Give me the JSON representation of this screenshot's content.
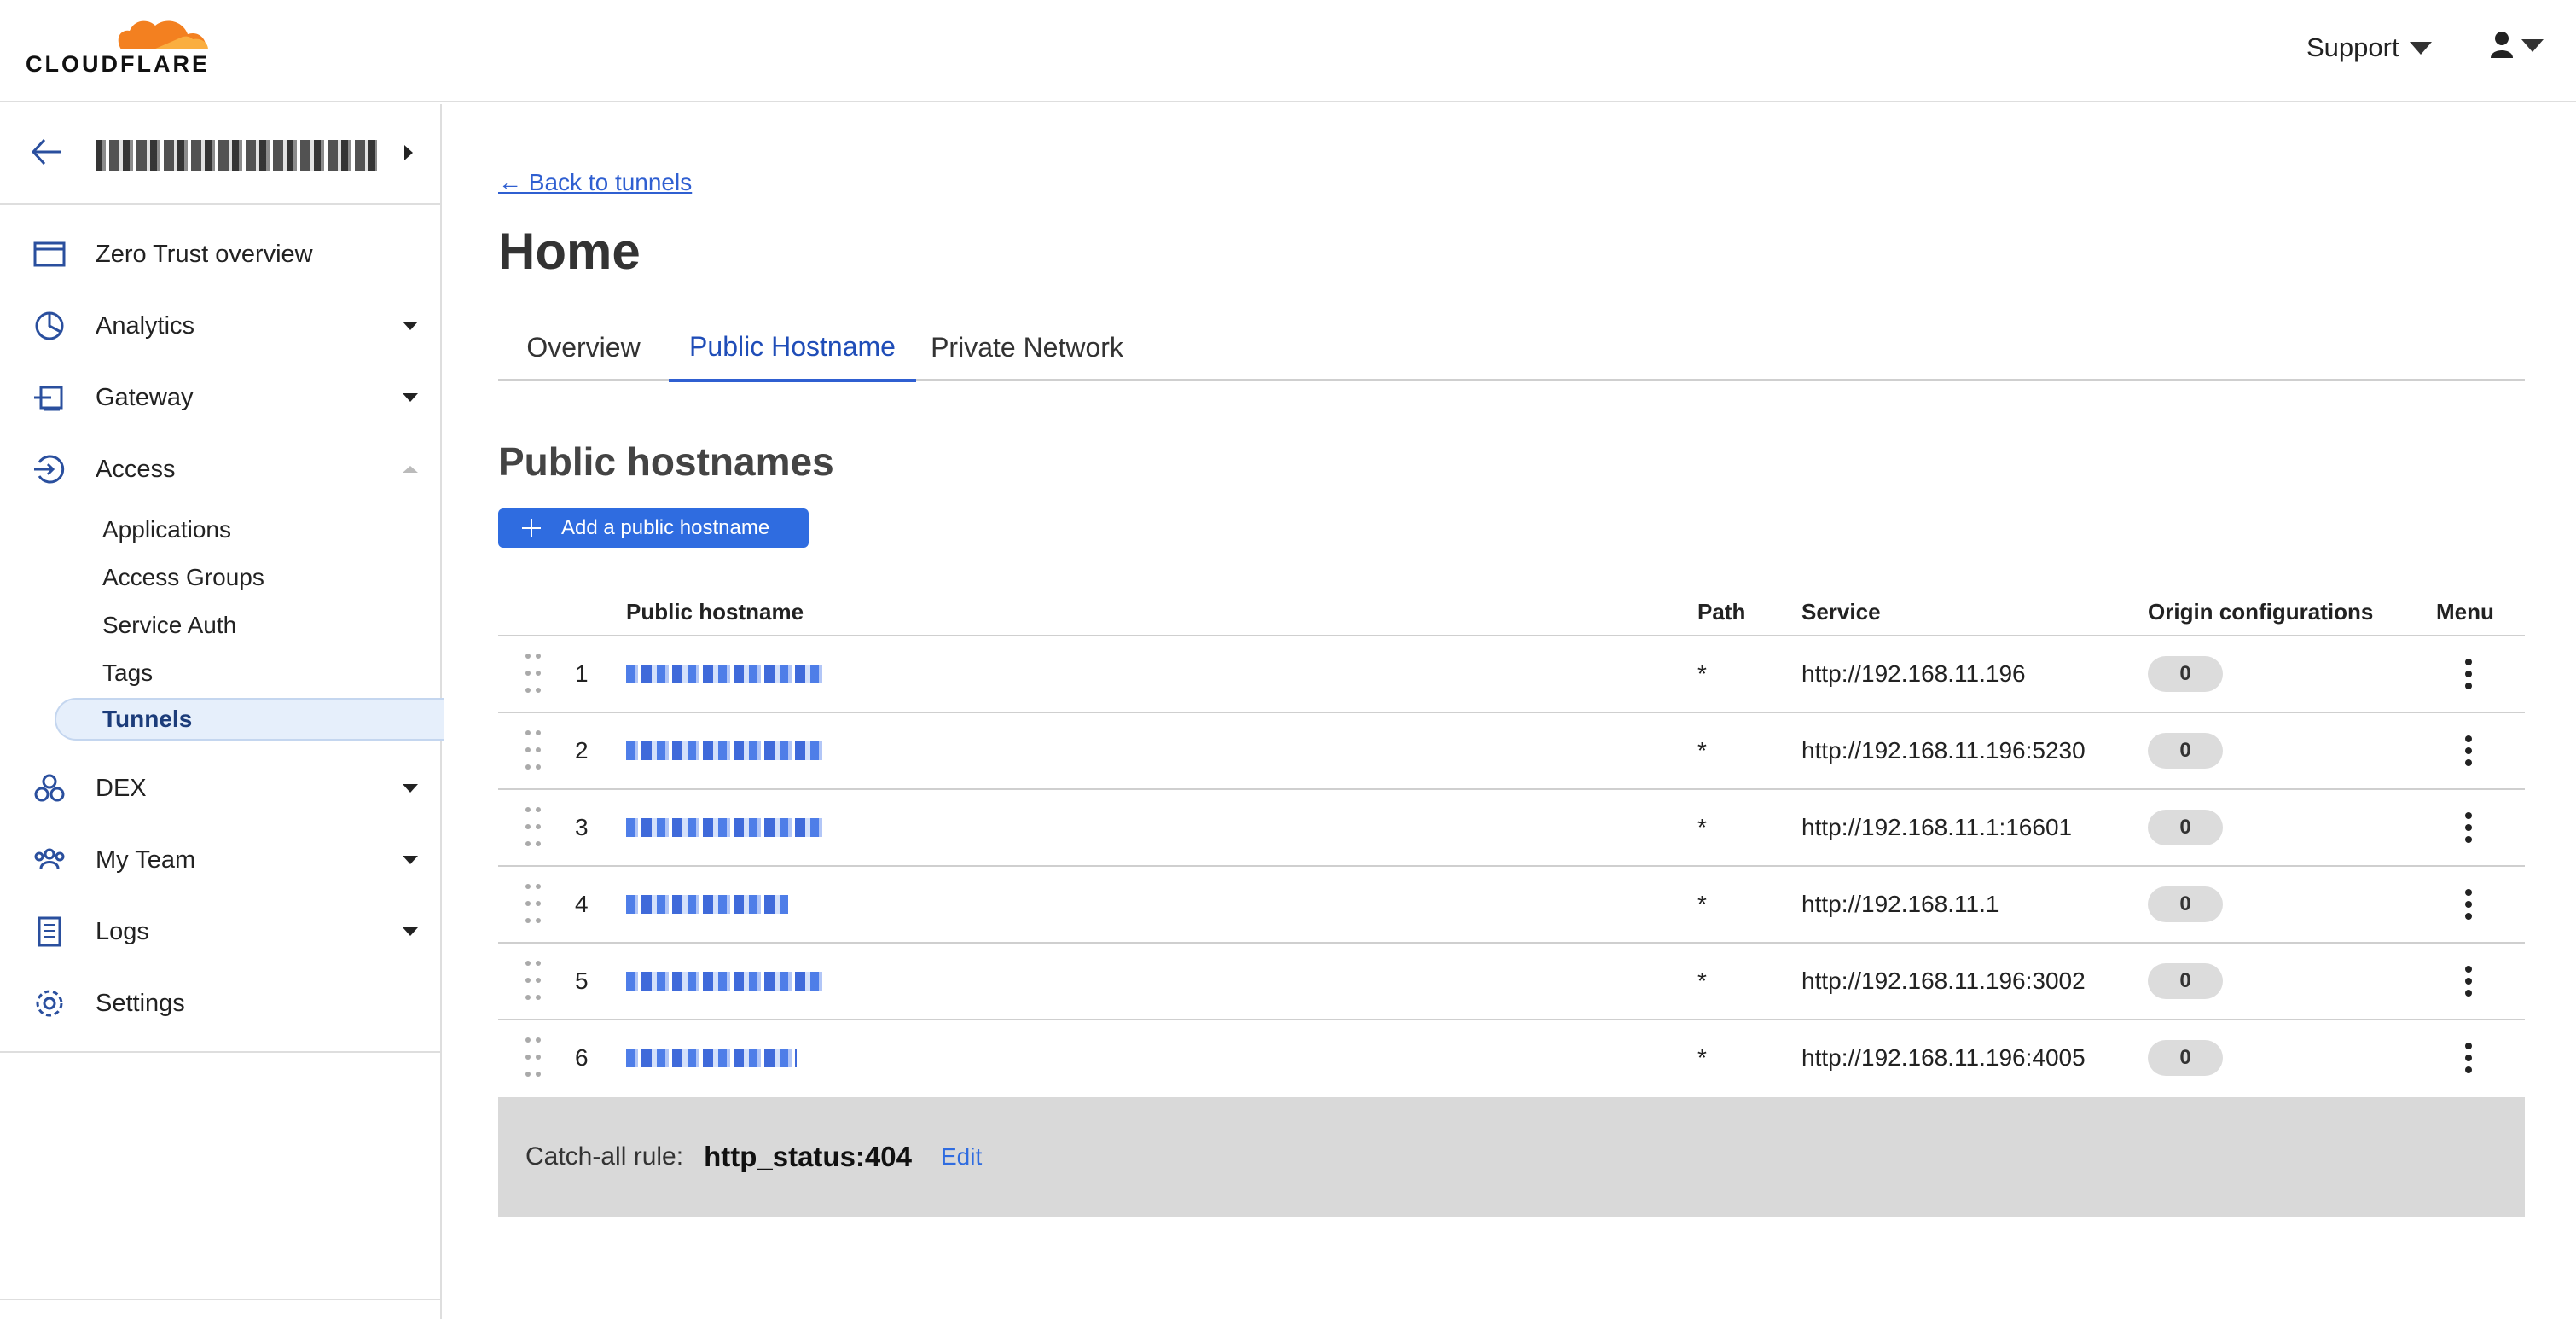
{
  "header": {
    "logo_text": "CLOUDFLARE",
    "support_label": "Support",
    "user_icon": "user-icon"
  },
  "sidebar": {
    "account_name": "",
    "items": [
      {
        "label": "Zero Trust overview",
        "icon": "browser-window-icon"
      },
      {
        "label": "Analytics",
        "icon": "pie-chart-icon"
      },
      {
        "label": "Gateway",
        "icon": "gateway-icon"
      },
      {
        "label": "Access",
        "icon": "access-icon"
      },
      {
        "label": "DEX",
        "icon": "dex-icon"
      },
      {
        "label": "My Team",
        "icon": "team-icon"
      },
      {
        "label": "Logs",
        "icon": "logs-icon"
      },
      {
        "label": "Settings",
        "icon": "gear-icon"
      }
    ],
    "access_subitems": [
      "Applications",
      "Access Groups",
      "Service Auth",
      "Tags",
      "Tunnels"
    ],
    "active_subitem": "Tunnels"
  },
  "main": {
    "back_link": "← Back to tunnels",
    "title": "Home",
    "tabs": [
      "Overview",
      "Public Hostname",
      "Private Network"
    ],
    "active_tab": "Public Hostname",
    "section_title": "Public hostnames",
    "add_button": "Add a public hostname",
    "columns": {
      "hostname": "Public hostname",
      "path": "Path",
      "service": "Service",
      "origin": "Origin configurations",
      "menu": "Menu"
    },
    "rows": [
      {
        "index": "1",
        "path": "*",
        "service": "http://192.168.11.196",
        "origin": "0"
      },
      {
        "index": "2",
        "path": "*",
        "service": "http://192.168.11.196:5230",
        "origin": "0"
      },
      {
        "index": "3",
        "path": "*",
        "service": "http://192.168.11.1:16601",
        "origin": "0"
      },
      {
        "index": "4",
        "path": "*",
        "service": "http://192.168.11.1",
        "origin": "0"
      },
      {
        "index": "5",
        "path": "*",
        "service": "http://192.168.11.196:3002",
        "origin": "0"
      },
      {
        "index": "6",
        "path": "*",
        "service": "http://192.168.11.196:4005",
        "origin": "0"
      }
    ],
    "catchall": {
      "label": "Catch-all rule:",
      "value": "http_status:404",
      "edit": "Edit"
    }
  },
  "colors": {
    "accent": "#2f6ce0",
    "link": "#2f5fd1",
    "logo_orange": "#f38020",
    "active_bg": "#e6effb"
  }
}
